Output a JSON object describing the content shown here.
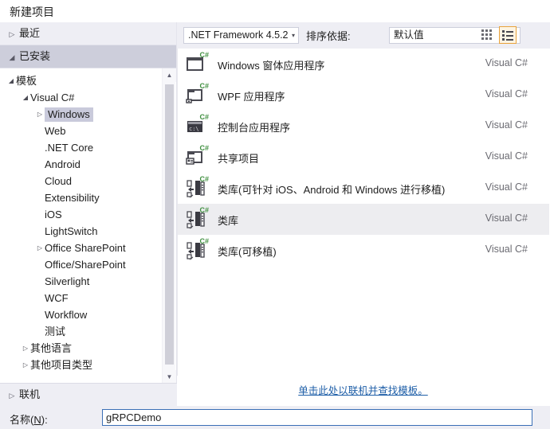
{
  "window": {
    "title": "新建项目"
  },
  "sidebar": {
    "recent": {
      "label": "最近",
      "arrow": "▷"
    },
    "installed": {
      "label": "已安装",
      "arrow": "◢"
    },
    "online": {
      "label": "联机",
      "arrow": "▷"
    },
    "tree": [
      {
        "label": "模板",
        "level": 0,
        "arrow": "◢",
        "selected": false
      },
      {
        "label": "Visual C#",
        "level": 1,
        "arrow": "◢",
        "selected": false
      },
      {
        "label": "Windows",
        "level": 2,
        "arrow": "▷",
        "selected": true
      },
      {
        "label": "Web",
        "level": 2,
        "arrow": "",
        "selected": false
      },
      {
        "label": ".NET Core",
        "level": 2,
        "arrow": "",
        "selected": false
      },
      {
        "label": "Android",
        "level": 2,
        "arrow": "",
        "selected": false
      },
      {
        "label": "Cloud",
        "level": 2,
        "arrow": "",
        "selected": false
      },
      {
        "label": "Extensibility",
        "level": 2,
        "arrow": "",
        "selected": false
      },
      {
        "label": "iOS",
        "level": 2,
        "arrow": "",
        "selected": false
      },
      {
        "label": "LightSwitch",
        "level": 2,
        "arrow": "",
        "selected": false
      },
      {
        "label": "Office SharePoint",
        "level": 2,
        "arrow": "▷",
        "selected": false
      },
      {
        "label": "Office/SharePoint",
        "level": 2,
        "arrow": "",
        "selected": false
      },
      {
        "label": "Silverlight",
        "level": 2,
        "arrow": "",
        "selected": false
      },
      {
        "label": "WCF",
        "level": 2,
        "arrow": "",
        "selected": false
      },
      {
        "label": "Workflow",
        "level": 2,
        "arrow": "",
        "selected": false
      },
      {
        "label": "测试",
        "level": 2,
        "arrow": "",
        "selected": false
      },
      {
        "label": "其他语言",
        "level": 1,
        "arrow": "▷",
        "selected": false
      },
      {
        "label": "其他项目类型",
        "level": 1,
        "arrow": "▷",
        "selected": false
      }
    ]
  },
  "toolbar": {
    "framework": {
      "value": ".NET Framework 4.5.2",
      "arrow": "▾"
    },
    "sort_label": "排序依据:",
    "sort": {
      "value": "默认值",
      "arrow": "▾"
    },
    "view_grid_icon": "grid-view-icon",
    "view_list_icon": "list-view-icon",
    "view_list_selected": true
  },
  "templates": {
    "lang_column": "Visual C#",
    "items": [
      {
        "name": "Windows 窗体应用程序",
        "lang": "Visual C#",
        "icon": "winforms-icon",
        "selected": false
      },
      {
        "name": "WPF 应用程序",
        "lang": "Visual C#",
        "icon": "wpf-icon",
        "selected": false
      },
      {
        "name": "控制台应用程序",
        "lang": "Visual C#",
        "icon": "console-icon",
        "selected": false
      },
      {
        "name": "共享项目",
        "lang": "Visual C#",
        "icon": "shared-project-icon",
        "selected": false
      },
      {
        "name": "类库(可针对 iOS、Android 和 Windows 进行移植)",
        "lang": "Visual C#",
        "icon": "portable-library-icon",
        "selected": false
      },
      {
        "name": "类库",
        "lang": "Visual C#",
        "icon": "class-library-icon",
        "selected": true
      },
      {
        "name": "类库(可移植)",
        "lang": "Visual C#",
        "icon": "portable-library-icon",
        "selected": false
      }
    ]
  },
  "online_link": {
    "text": "单击此处以联机并查找模板。"
  },
  "bottom": {
    "name_label_prefix": "名称(",
    "name_label_key": "N",
    "name_label_suffix": "):",
    "name_value": "gRPCDemo"
  },
  "colors": {
    "chrome": "#eeeef4",
    "selected_tree": "#c9cadb",
    "installed_header": "#cdcedb",
    "selected_row": "#ededf0",
    "link": "#1f5fa8",
    "accent_orange": "#e8a33d",
    "cs_green": "#3f8f3f"
  }
}
